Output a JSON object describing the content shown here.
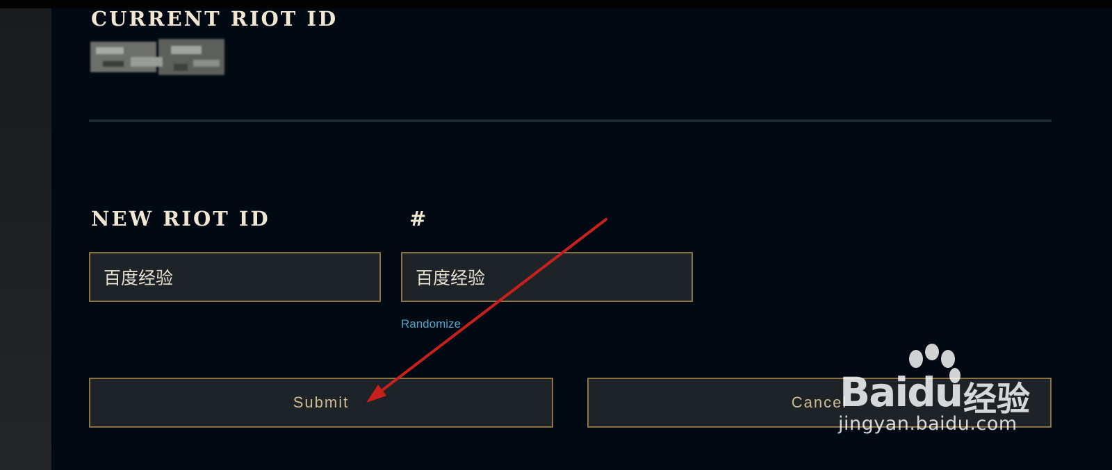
{
  "current_section": {
    "heading": "CURRENT RIOT ID"
  },
  "new_section": {
    "heading": "NEW RIOT ID",
    "hash_label": "#",
    "name_value": "百度经验",
    "tag_value": "百度经验",
    "randomize_label": "Randomize"
  },
  "buttons": {
    "submit_label": "Submit",
    "cancel_label": "Cancel"
  },
  "watermark": {
    "logo_text": "Baidu",
    "jingyan_text": "经验",
    "url_text": "jingyan.baidu.com"
  },
  "colors": {
    "panel_bg": "#010a13",
    "gold_border": "#8a7446",
    "heading_text": "#f0e6d2",
    "button_text": "#cdbe91",
    "link": "#4fa8c9",
    "annotation_arrow": "#c8201c"
  },
  "icons": {
    "annotation": "arrow-icon",
    "watermark": "baidu-paw-icon"
  }
}
